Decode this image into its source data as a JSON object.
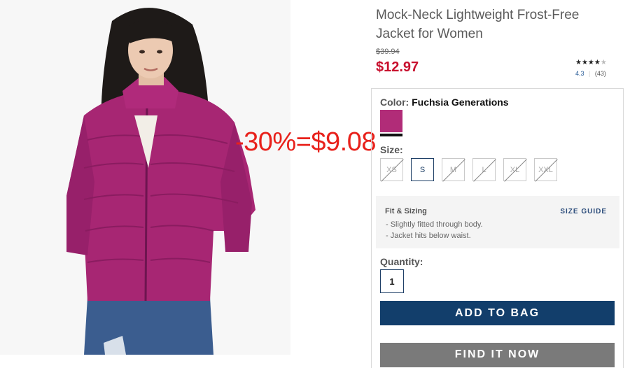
{
  "product": {
    "title": "Mock-Neck Lightweight Frost-Free Jacket for Women",
    "original_price": "$39.94",
    "sale_price": "$12.97",
    "overlay_text": "-30%=$9.08",
    "rating": {
      "stars_filled": 4,
      "stars_total": 5,
      "average": "4.3",
      "count": "(43)"
    }
  },
  "color": {
    "label": "Color:",
    "value": "Fuchsia Generations",
    "swatch": "#b12c78"
  },
  "sizes": {
    "label": "Size:",
    "options": [
      {
        "label": "XS",
        "available": false
      },
      {
        "label": "S",
        "available": true,
        "selected": true
      },
      {
        "label": "M",
        "available": false
      },
      {
        "label": "L",
        "available": false
      },
      {
        "label": "XL",
        "available": false
      },
      {
        "label": "XXL",
        "available": false
      }
    ]
  },
  "fit": {
    "title": "Fit & Sizing",
    "guide_link": "SIZE GUIDE",
    "notes": [
      "- Slightly fitted through body.",
      "- Jacket hits below waist."
    ]
  },
  "quantity": {
    "label": "Quantity:",
    "value": "1"
  },
  "buttons": {
    "add_to_bag": "ADD TO BAG",
    "find_it_now": "FIND IT NOW"
  },
  "colors": {
    "sale": "#c8102e",
    "overlay": "#e8211b",
    "primary_button": "#123e6b"
  }
}
